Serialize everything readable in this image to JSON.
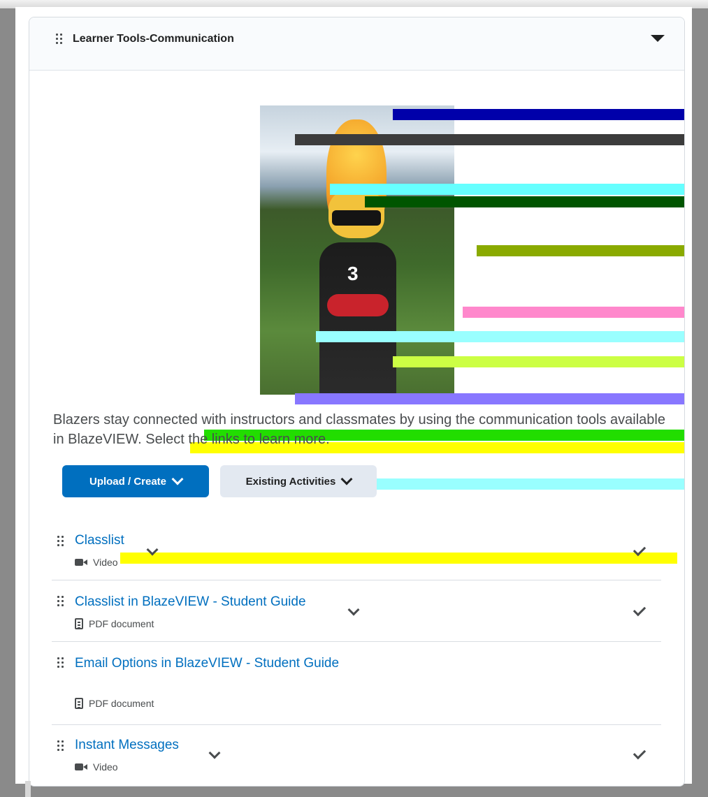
{
  "module": {
    "title": "Learner Tools-Communication"
  },
  "intro_text": "Blazers stay connected with instructors and classmates by using the communication tools available in BlazeVIEW. Select the links to learn more.",
  "buttons": {
    "upload_create": "Upload / Create",
    "existing_activities": "Existing Activities"
  },
  "items": [
    {
      "title": "Classlist",
      "type": "Video",
      "completed": true
    },
    {
      "title": "Classlist in BlazeVIEW - Student Guide",
      "type": "PDF document",
      "completed": true
    },
    {
      "title": "Email Options in BlazeVIEW - Student Guide",
      "type": "PDF document",
      "completed": false
    },
    {
      "title": "Instant Messages",
      "type": "Video",
      "completed": true
    }
  ],
  "colors": {
    "link": "#006fbf",
    "primary_button": "#006fbf",
    "secondary_button": "#e3e9f1",
    "text": "#494c4e"
  },
  "icons": [
    "drag-handle-icon",
    "collapse-arrow-icon",
    "chevron-down-icon",
    "video-icon",
    "document-icon",
    "checkmark-icon"
  ]
}
